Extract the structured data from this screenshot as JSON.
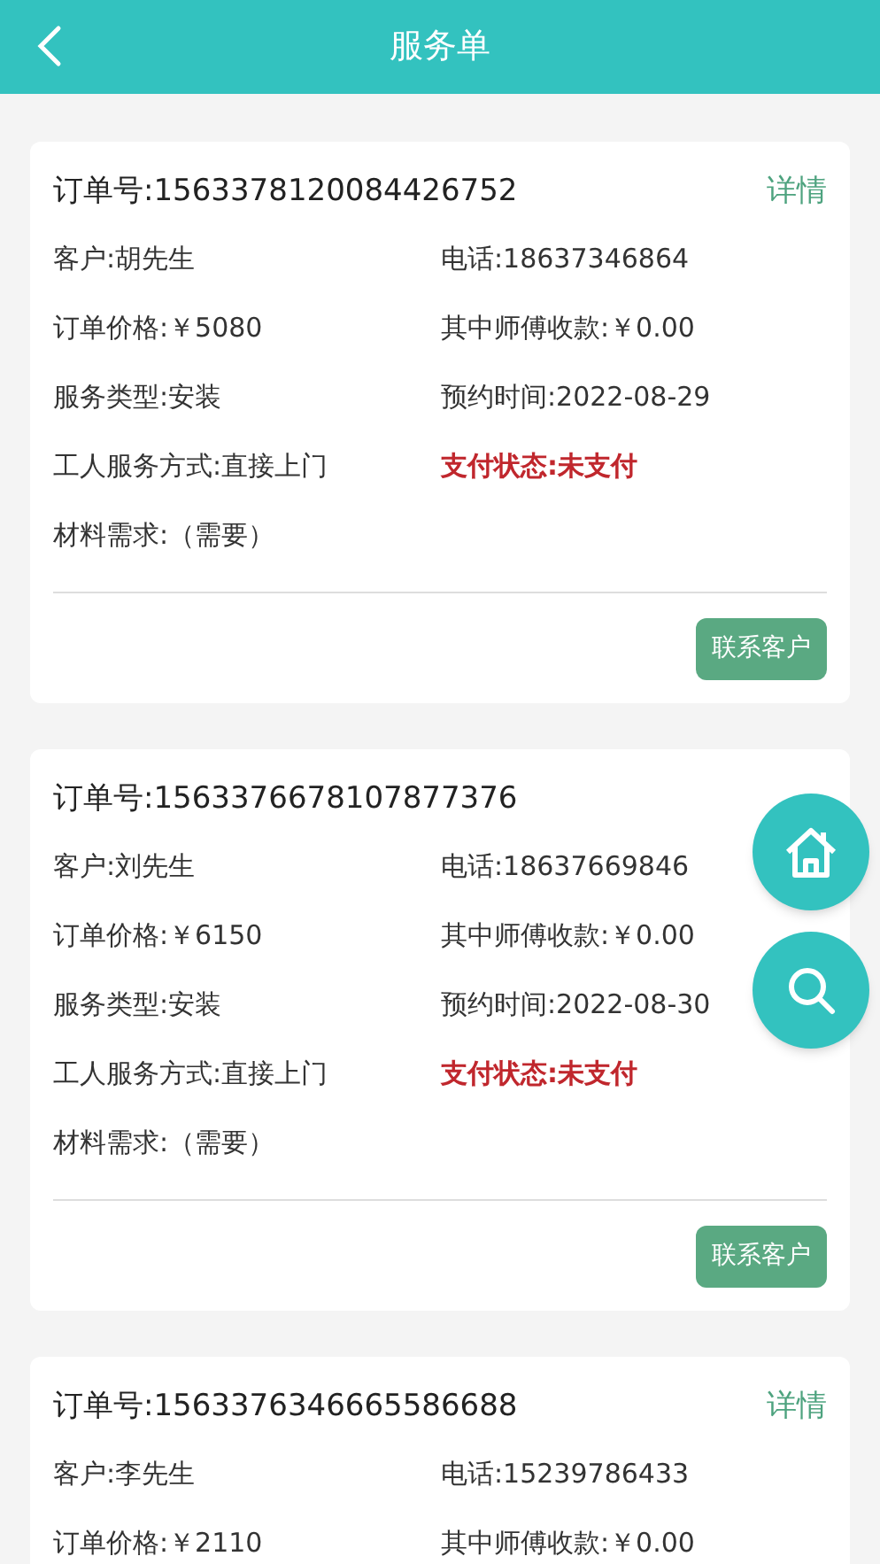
{
  "header": {
    "title": "服务单"
  },
  "orders": [
    {
      "order_no": "订单号:1563378120084426752",
      "detail": "详情",
      "fields": [
        {
          "text": "客户:胡先生",
          "kind": "normal"
        },
        {
          "text": "电话:18637346864",
          "kind": "normal"
        },
        {
          "text": "订单价格:￥5080",
          "kind": "normal"
        },
        {
          "text": "其中师傅收款:￥0.00",
          "kind": "normal"
        },
        {
          "text": "服务类型:安装",
          "kind": "normal"
        },
        {
          "text": "预约时间:2022-08-29",
          "kind": "normal"
        },
        {
          "text": "工人服务方式:直接上门",
          "kind": "normal"
        },
        {
          "text": "支付状态:未支付",
          "kind": "alert"
        },
        {
          "text": "材料需求:（需要）",
          "kind": "normal"
        }
      ],
      "contact_button": "联系客户"
    },
    {
      "order_no": "订单号:1563376678107877376",
      "fields": [
        {
          "text": "客户:刘先生",
          "kind": "normal"
        },
        {
          "text": "电话:18637669846",
          "kind": "normal"
        },
        {
          "text": "订单价格:￥6150",
          "kind": "normal"
        },
        {
          "text": "其中师傅收款:￥0.00",
          "kind": "normal"
        },
        {
          "text": "服务类型:安装",
          "kind": "normal"
        },
        {
          "text": "预约时间:2022-08-30",
          "kind": "normal"
        },
        {
          "text": "工人服务方式:直接上门",
          "kind": "normal"
        },
        {
          "text": "支付状态:未支付",
          "kind": "alert"
        },
        {
          "text": "材料需求:（需要）",
          "kind": "normal"
        }
      ],
      "contact_button": "联系客户"
    },
    {
      "order_no": "订单号:1563376346665586688",
      "detail": "详情",
      "fields": [
        {
          "text": "客户:李先生",
          "kind": "normal"
        },
        {
          "text": "电话:15239786433",
          "kind": "normal"
        },
        {
          "text": "订单价格:￥2110",
          "kind": "normal"
        },
        {
          "text": "其中师傅收款:￥0.00",
          "kind": "normal"
        }
      ]
    }
  ]
}
